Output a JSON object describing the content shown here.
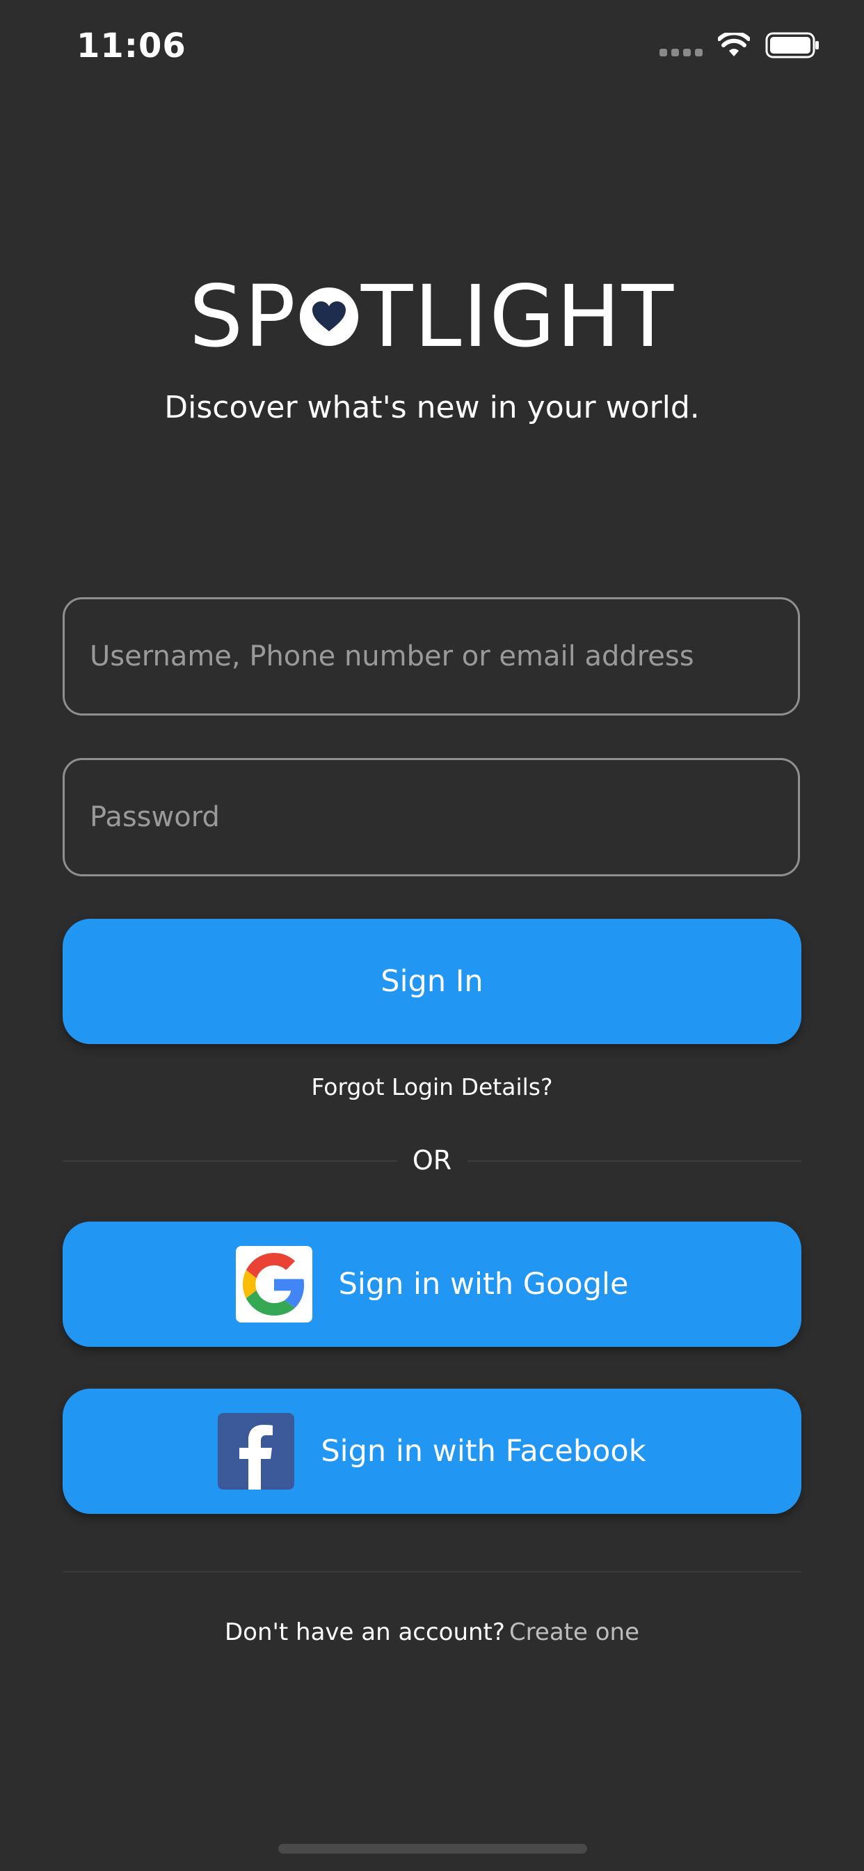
{
  "status_bar": {
    "time": "11:06"
  },
  "brand": {
    "name_part1": "SP",
    "name_part2": "TLIGHT",
    "tagline": "Discover what's new in your world."
  },
  "form": {
    "username_placeholder": "Username, Phone number or email address",
    "password_placeholder": "Password",
    "signin_label": "Sign In",
    "forgot_label": "Forgot Login Details?",
    "or_label": "OR",
    "google_label": "Sign in with Google",
    "facebook_label": "Sign in with Facebook"
  },
  "footer": {
    "prompt": "Don't have an account?",
    "link": "Create one"
  },
  "colors": {
    "background": "#2d2d2e",
    "accent": "#2196f3",
    "heart": "#1e2d4d",
    "facebook": "#3b5998"
  },
  "icons": [
    "signal-icon",
    "wifi-icon",
    "battery-icon",
    "heart-icon",
    "google-icon",
    "facebook-icon"
  ]
}
